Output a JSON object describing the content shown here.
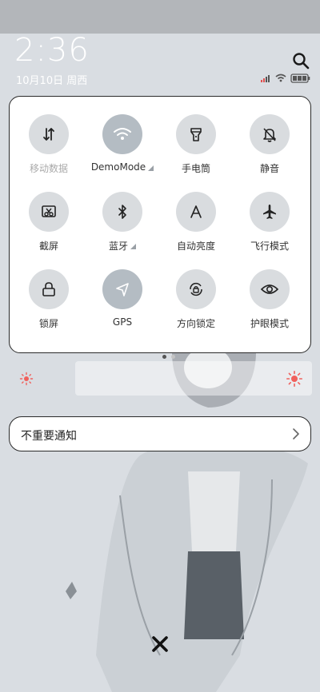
{
  "status": {
    "time": "2:36",
    "date": "10月10日 周西"
  },
  "quick_settings": {
    "tiles": [
      {
        "label": "移动数据",
        "icon": "mobile-data-icon",
        "active": false,
        "dim": true
      },
      {
        "label": "DemoMode",
        "icon": "wifi-icon",
        "active": true,
        "expand": true
      },
      {
        "label": "手电筒",
        "icon": "flashlight-icon",
        "active": false
      },
      {
        "label": "静音",
        "icon": "mute-bell-icon",
        "active": false
      },
      {
        "label": "截屏",
        "icon": "screenshot-icon",
        "active": false
      },
      {
        "label": "蓝牙",
        "icon": "bluetooth-icon",
        "active": false,
        "expand": true
      },
      {
        "label": "自动亮度",
        "icon": "auto-brightness-icon",
        "active": false
      },
      {
        "label": "飞行模式",
        "icon": "airplane-icon",
        "active": false
      },
      {
        "label": "锁屏",
        "icon": "lock-icon",
        "active": false
      },
      {
        "label": "GPS",
        "icon": "gps-icon",
        "active": true
      },
      {
        "label": "方向锁定",
        "icon": "rotation-lock-icon",
        "active": false
      },
      {
        "label": "护眼模式",
        "icon": "eye-icon",
        "active": false
      }
    ],
    "page_count": 2,
    "current_page": 1
  },
  "notification_group": {
    "label": "不重要通知"
  },
  "colors": {
    "accent_sun": "#f0605c",
    "active_tile": "#b4bcc3",
    "inactive_tile": "#d9dcdf"
  }
}
